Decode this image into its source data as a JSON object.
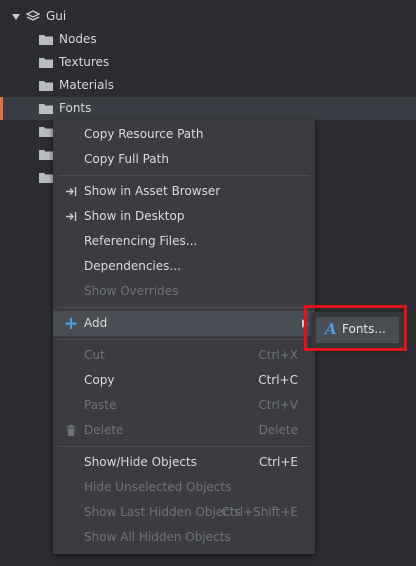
{
  "tree": {
    "root": {
      "label": "Gui",
      "expanded": true
    },
    "items": [
      {
        "label": "Nodes"
      },
      {
        "label": "Textures"
      },
      {
        "label": "Materials"
      },
      {
        "label": "Fonts",
        "selected": true
      },
      {
        "label": ""
      },
      {
        "label": ""
      },
      {
        "label": ""
      }
    ]
  },
  "context_menu": {
    "copy_resource_path": "Copy Resource Path",
    "copy_full_path": "Copy Full Path",
    "show_in_asset_browser": "Show in Asset Browser",
    "show_in_desktop": "Show in Desktop",
    "referencing_files": "Referencing Files...",
    "dependencies": "Dependencies...",
    "show_overrides": "Show Overrides",
    "add": "Add",
    "cut": {
      "label": "Cut",
      "shortcut": "Ctrl+X"
    },
    "copy": {
      "label": "Copy",
      "shortcut": "Ctrl+C"
    },
    "paste": {
      "label": "Paste",
      "shortcut": "Ctrl+V"
    },
    "delete": {
      "label": "Delete",
      "shortcut": "Delete"
    },
    "show_hide_objects": {
      "label": "Show/Hide Objects",
      "shortcut": "Ctrl+E"
    },
    "hide_unselected": "Hide Unselected Objects",
    "show_last_hidden": {
      "label": "Show Last Hidden Objects",
      "shortcut": "Ctrl+Shift+E"
    },
    "show_all_hidden": "Show All Hidden Objects"
  },
  "add_submenu": {
    "fonts": "Fonts..."
  },
  "colors": {
    "background": "#2b2d31",
    "menu_bg": "#3a3c40",
    "selection_accent": "#e8713c",
    "add_icon": "#4d9be0",
    "highlight": "#e0131a"
  }
}
